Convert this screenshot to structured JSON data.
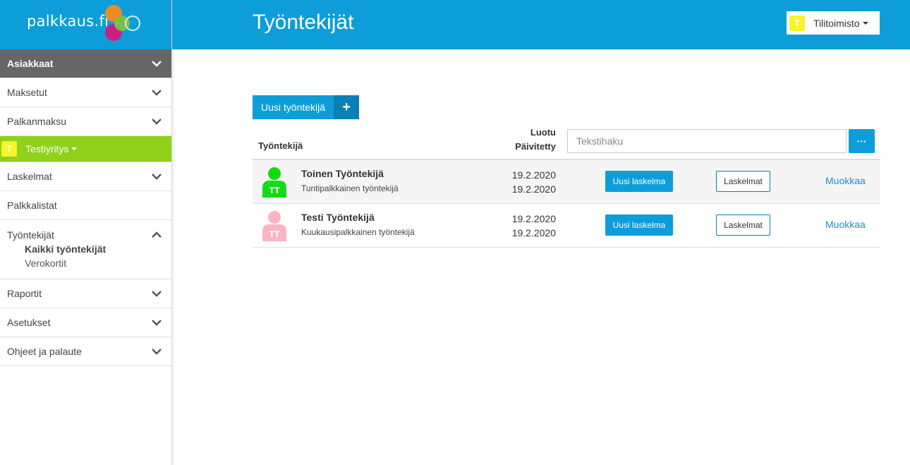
{
  "brand": {
    "logo_text": "palkkaus.fi"
  },
  "colors": {
    "primary": "#0d9dd8",
    "primary_dark": "#0a7fb4",
    "company_bar": "#8fd11b",
    "badge": "#f5f52a",
    "active_nav": "#666666"
  },
  "sidebar": {
    "items": [
      {
        "label": "Asiakkaat",
        "icon": "chevron-down-icon"
      },
      {
        "label": "Maksetut",
        "icon": "chevron-down-icon"
      },
      {
        "label": "Palkanmaksu",
        "icon": "chevron-down-icon"
      }
    ],
    "company": {
      "badge": "T",
      "name": "Testiyritys"
    },
    "items2": [
      {
        "label": "Laskelmat",
        "icon": "chevron-down-icon"
      },
      {
        "label": "Palkkalistat"
      }
    ],
    "group": {
      "label": "Työntekijät",
      "icon": "chevron-up-icon",
      "sub": [
        {
          "label": "Kaikki työntekijät"
        },
        {
          "label": "Verokortit"
        }
      ]
    },
    "items3": [
      {
        "label": "Raportit",
        "icon": "chevron-down-icon"
      },
      {
        "label": "Asetukset",
        "icon": "chevron-down-icon"
      },
      {
        "label": "Ohjeet ja palaute",
        "icon": "chevron-down-icon"
      }
    ]
  },
  "header": {
    "title": "Työntekijät",
    "account": {
      "badge": "T",
      "label": "Tilitoimisto"
    }
  },
  "main": {
    "new_button": "Uusi työntekijä",
    "new_button_icon": "plus-icon",
    "columns": {
      "employee": "Työntekijä",
      "created": "Luotu",
      "updated": "Päivitetty"
    },
    "search": {
      "placeholder": "Tekstihaku",
      "value": ""
    },
    "more_button": "···",
    "rows": [
      {
        "name": "Toinen Työntekijä",
        "type": "Tuntipalkkainen työntekijä",
        "initials": "TT",
        "avatar_color": "#16d916",
        "created": "19.2.2020",
        "updated": "19.2.2020",
        "new_calc": "Uusi laskelma",
        "calcs": "Laskelmat",
        "edit": "Muokkaa"
      },
      {
        "name": "Testi Työntekijä",
        "type": "Kuukausipalkkainen työntekijä",
        "initials": "TT",
        "avatar_color": "#f7b6c4",
        "created": "19.2.2020",
        "updated": "19.2.2020",
        "new_calc": "Uusi laskelma",
        "calcs": "Laskelmat",
        "edit": "Muokkaa"
      }
    ]
  }
}
